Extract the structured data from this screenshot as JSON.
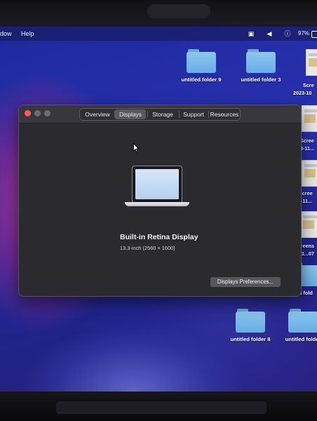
{
  "menubar": {
    "partial_item": "dow",
    "help": "Help",
    "battery": "97%"
  },
  "desktop": {
    "folders": [
      {
        "label": "untitled folder 9"
      },
      {
        "label": "untitled folder 3"
      },
      {
        "label": "untitled folder 8"
      },
      {
        "label": "untitled folder"
      }
    ],
    "files": [
      {
        "label_line1": "Scre",
        "label_line2": "2023-10"
      },
      {
        "label_line1": "Scree",
        "label_line2": "23-11..."
      },
      {
        "label_line1": "Scree",
        "label_line2": "23-11..."
      },
      {
        "label_line1": "Screens",
        "label_line2": "23-11...07"
      },
      {
        "label_line1": "ntitled fold",
        "label_line2": ""
      }
    ]
  },
  "window": {
    "tabs": [
      "Overview",
      "Displays",
      "Storage",
      "Support",
      "Resources"
    ],
    "active_tab": "Displays",
    "display_name": "Built-in Retina Display",
    "display_detail": "13.3-inch (2560 × 1600)",
    "preferences_button": "Displays Preferences..."
  },
  "icons": [
    "apple-logo-icon",
    "screen-mirroring-icon",
    "volume-icon",
    "info-icon",
    "battery-icon",
    "cursor-icon",
    "folder-icon"
  ]
}
